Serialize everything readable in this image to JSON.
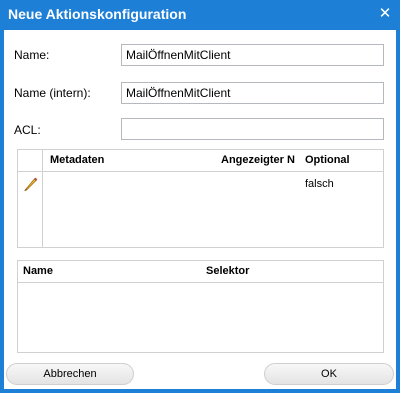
{
  "dialog": {
    "title": "Neue Aktionskonfiguration",
    "close_icon": "close-icon"
  },
  "form": {
    "name_label": "Name:",
    "name_value": "MailÖffnenMitClient",
    "internal_name_label": "Name (intern):",
    "internal_name_value": "MailÖffnenMitClient",
    "acl_label": "ACL:",
    "acl_value": ""
  },
  "metadata_grid": {
    "columns": [
      "Metadaten",
      "Angezeigter N",
      "Optional"
    ],
    "rows": [
      {
        "icon": "pencil-icon",
        "metadaten": "",
        "angezeigter_name": "",
        "optional": "falsch"
      }
    ]
  },
  "selector_grid": {
    "columns": [
      "Name",
      "Selektor"
    ],
    "rows": []
  },
  "buttons": {
    "cancel": "Abbrechen",
    "ok": "OK"
  },
  "colors": {
    "titlebar": "#1d7fd6",
    "pencil": "#e0a21a"
  }
}
